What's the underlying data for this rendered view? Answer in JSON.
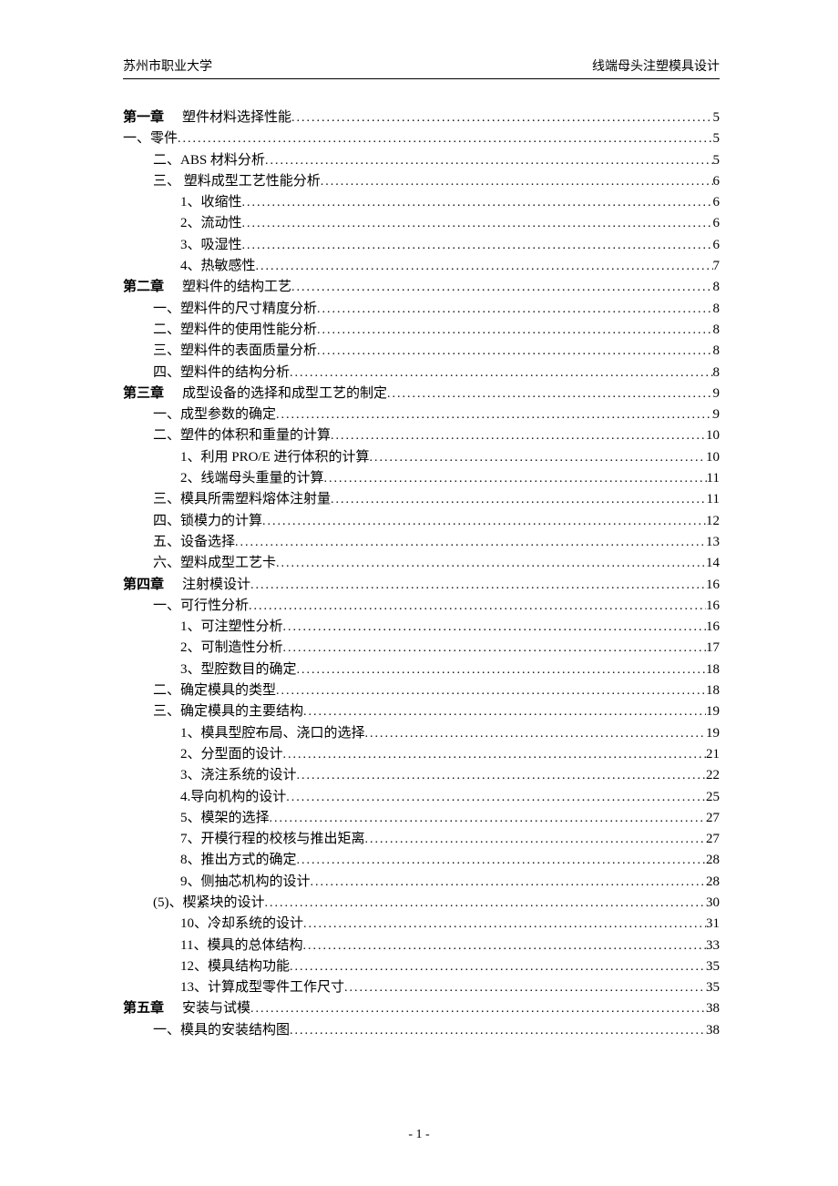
{
  "header": {
    "left": "苏州市职业大学",
    "right": "线端母头注塑模具设计"
  },
  "toc": [
    {
      "label": "第一章",
      "title": "塑件材料选择性能",
      "page": "5",
      "indent": 0,
      "chapter": true
    },
    {
      "label": "一、",
      "title": "零件",
      "page": "5",
      "indent": 0
    },
    {
      "label": "二、",
      "title": "ABS 材料分析",
      "page": "5",
      "indent": 1
    },
    {
      "label": "三、",
      "title": " 塑料成型工艺性能分析",
      "page": "6",
      "indent": 1
    },
    {
      "label": "1、",
      "title": "收缩性",
      "page": "6",
      "indent": 2
    },
    {
      "label": "2、",
      "title": "流动性",
      "page": "6",
      "indent": 2
    },
    {
      "label": "3、",
      "title": "吸湿性",
      "page": "6",
      "indent": 2
    },
    {
      "label": "4、",
      "title": "热敏感性",
      "page": "7",
      "indent": 2
    },
    {
      "label": "第二章",
      "title": "塑料件的结构工艺",
      "page": "8",
      "indent": 0,
      "chapter": true
    },
    {
      "label": "一、",
      "title": "塑料件的尺寸精度分析",
      "page": "8",
      "indent": 1
    },
    {
      "label": "二、",
      "title": "塑料件的使用性能分析",
      "page": "8",
      "indent": 1
    },
    {
      "label": "三、",
      "title": "塑料件的表面质量分析",
      "page": "8",
      "indent": 1
    },
    {
      "label": "四、",
      "title": "塑料件的结构分析",
      "page": "8",
      "indent": 1
    },
    {
      "label": "第三章",
      "title": "成型设备的选择和成型工艺的制定",
      "page": "9",
      "indent": 0,
      "chapter": true
    },
    {
      "label": "一、",
      "title": "成型参数的确定",
      "page": "9",
      "indent": 1
    },
    {
      "label": "二、",
      "title": "塑件的体积和重量的计算",
      "page": "10",
      "indent": 1
    },
    {
      "label": "1、",
      "title": "利用 PRO/E 进行体积的计算",
      "page": "10",
      "indent": 2
    },
    {
      "label": "2、",
      "title": "线端母头重量的计算",
      "page": "11",
      "indent": 2
    },
    {
      "label": "三、",
      "title": "模具所需塑料熔体注射量",
      "page": "11",
      "indent": 1
    },
    {
      "label": "四、",
      "title": "锁模力的计算",
      "page": "12",
      "indent": 1
    },
    {
      "label": "五、",
      "title": "设备选择",
      "page": "13",
      "indent": 1
    },
    {
      "label": "六、",
      "title": "塑料成型工艺卡",
      "page": "14",
      "indent": 1
    },
    {
      "label": "第四章",
      "title": "注射模设计",
      "page": "16",
      "indent": 0,
      "chapter": true
    },
    {
      "label": "一、",
      "title": "可行性分析",
      "page": "16",
      "indent": 1
    },
    {
      "label": "1、",
      "title": "可注塑性分析",
      "page": "16",
      "indent": 2
    },
    {
      "label": "2、",
      "title": "可制造性分析",
      "page": "17",
      "indent": 2
    },
    {
      "label": "3、",
      "title": "型腔数目的确定",
      "page": "18",
      "indent": 2
    },
    {
      "label": "二、",
      "title": "确定模具的类型",
      "page": "18",
      "indent": 1
    },
    {
      "label": "三、",
      "title": "确定模具的主要结构",
      "page": "19",
      "indent": 1
    },
    {
      "label": "1、",
      "title": "模具型腔布局、浇口的选择",
      "page": "19",
      "indent": 2
    },
    {
      "label": "2、",
      "title": "分型面的设计",
      "page": "21",
      "indent": 2
    },
    {
      "label": "3、",
      "title": "浇注系统的设计",
      "page": "22",
      "indent": 2
    },
    {
      "label": "4.",
      "title": "导向机构的设计",
      "page": "25",
      "indent": 2
    },
    {
      "label": "5、",
      "title": "模架的选择",
      "page": "27",
      "indent": 2
    },
    {
      "label": "7、",
      "title": "开模行程的校核与推出矩离",
      "page": "27",
      "indent": 2
    },
    {
      "label": "8、",
      "title": "推出方式的确定",
      "page": "28",
      "indent": 2
    },
    {
      "label": "9、",
      "title": "侧抽芯机构的设计",
      "page": "28",
      "indent": 2
    },
    {
      "label": "(5)、",
      "title": "楔紧块的设计",
      "page": "30",
      "indent": 1
    },
    {
      "label": "10、",
      "title": "冷却系统的设计",
      "page": "31",
      "indent": 2
    },
    {
      "label": "11、",
      "title": "模具的总体结构",
      "page": "33",
      "indent": 2
    },
    {
      "label": "12、",
      "title": "模具结构功能",
      "page": "35",
      "indent": 2
    },
    {
      "label": "13、",
      "title": "计算成型零件工作尺寸",
      "page": "35",
      "indent": 2
    },
    {
      "label": "第五章",
      "title": "安装与试模",
      "page": "38",
      "indent": 0,
      "chapter": true
    },
    {
      "label": "一、",
      "title": "模具的安装结构图",
      "page": "38",
      "indent": 1
    }
  ],
  "footer": "- 1 -"
}
